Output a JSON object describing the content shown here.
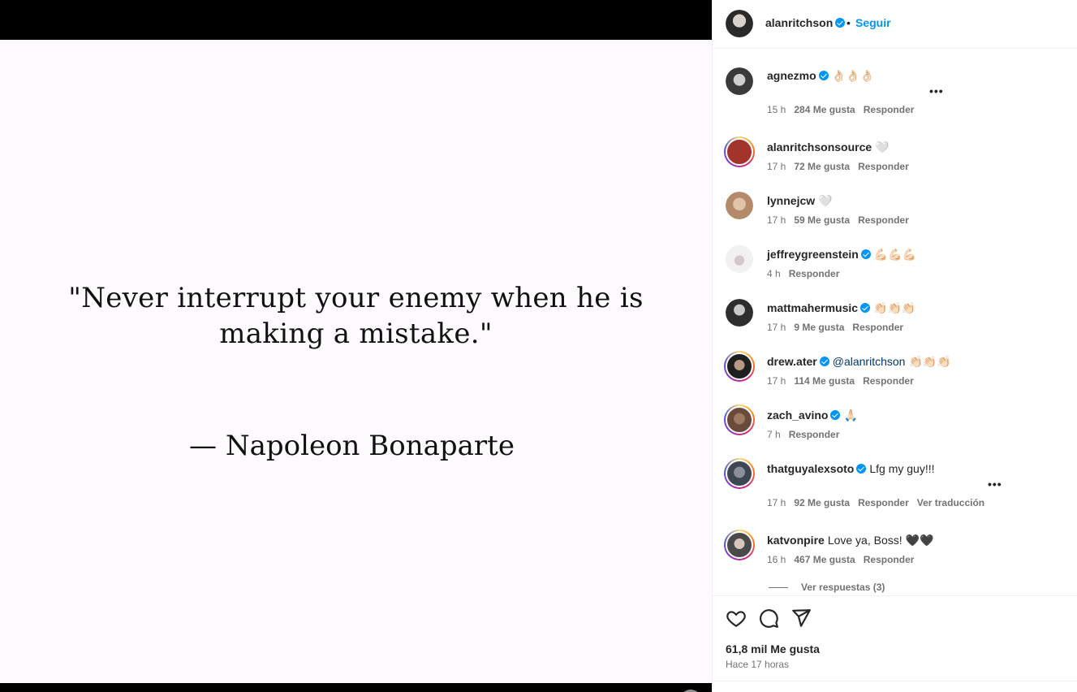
{
  "post": {
    "quote": "\"Never interrupt your enemy when he is making a mistake.\"",
    "author": "— Napoleon Bonaparte"
  },
  "header": {
    "username": "alanritchson",
    "dot": "•",
    "follow_label": "Seguir"
  },
  "comments": [
    {
      "username": "agnezmo",
      "verified": true,
      "text": "👌🏻👌🏻👌🏻",
      "time": "15 h",
      "likes": "284 Me gusta",
      "reply": "Responder",
      "translate": "",
      "avatar_color": "#3a3a3a",
      "ring": false
    },
    {
      "username": "alanritchsonsource",
      "verified": false,
      "text": "🤍",
      "time": "17 h",
      "likes": "72 Me gusta",
      "reply": "Responder",
      "translate": "",
      "avatar_color": "#a2342c",
      "ring": true
    },
    {
      "username": "lynnejcw",
      "verified": false,
      "text": "🤍",
      "time": "17 h",
      "likes": "59 Me gusta",
      "reply": "Responder",
      "translate": "",
      "avatar_color": "#b48a6a",
      "ring": false
    },
    {
      "username": "jeffreygreenstein",
      "verified": true,
      "text": "💪🏻💪🏻💪🏻",
      "time": "4 h",
      "likes": "",
      "reply": "Responder",
      "translate": "",
      "avatar_color": "#e6e3e4",
      "ring": false
    },
    {
      "username": "mattmahermusic",
      "verified": true,
      "text": "👏🏻👏🏻👏🏻",
      "time": "17 h",
      "likes": "9 Me gusta",
      "reply": "Responder",
      "translate": "",
      "avatar_color": "#2e2e2e",
      "ring": false
    },
    {
      "username": "drew.ater",
      "verified": true,
      "mention": "@alanritchson",
      "text": "👏🏻👏🏻👏🏻",
      "time": "17 h",
      "likes": "114 Me gusta",
      "reply": "Responder",
      "translate": "",
      "avatar_color": "#1f1f1f",
      "ring": true
    },
    {
      "username": "zach_avino",
      "verified": true,
      "text": "🙏🏻",
      "time": "7 h",
      "likes": "",
      "reply": "Responder",
      "translate": "",
      "avatar_color": "#6a4a3a",
      "ring": true
    },
    {
      "username": "thatguyalexsoto",
      "verified": true,
      "text": "Lfg my guy!!!",
      "time": "17 h",
      "likes": "92 Me gusta",
      "reply": "Responder",
      "translate": "Ver traducción",
      "avatar_color": "#3d4752",
      "ring": true
    },
    {
      "username": "katvonpire",
      "verified": false,
      "text": "Love ya, Boss! 🖤🖤",
      "time": "16 h",
      "likes": "467 Me gusta",
      "reply": "Responder",
      "translate": "",
      "avatar_color": "#4a4a4a",
      "ring": true
    }
  ],
  "view_replies": "Ver respuestas (3)",
  "footer": {
    "likes": "61,8 mil Me gusta",
    "time": "Hace 17 horas"
  },
  "icons": {
    "like": "heart-icon",
    "comment": "comment-icon",
    "share": "share-icon",
    "mute": "speaker-muted-icon",
    "more": "more-options-icon",
    "verified": "verified-badge-icon"
  },
  "colors": {
    "accent": "#0095f6",
    "verified": "#0095f6",
    "mention": "#00376b",
    "secondary_text": "#737373"
  }
}
